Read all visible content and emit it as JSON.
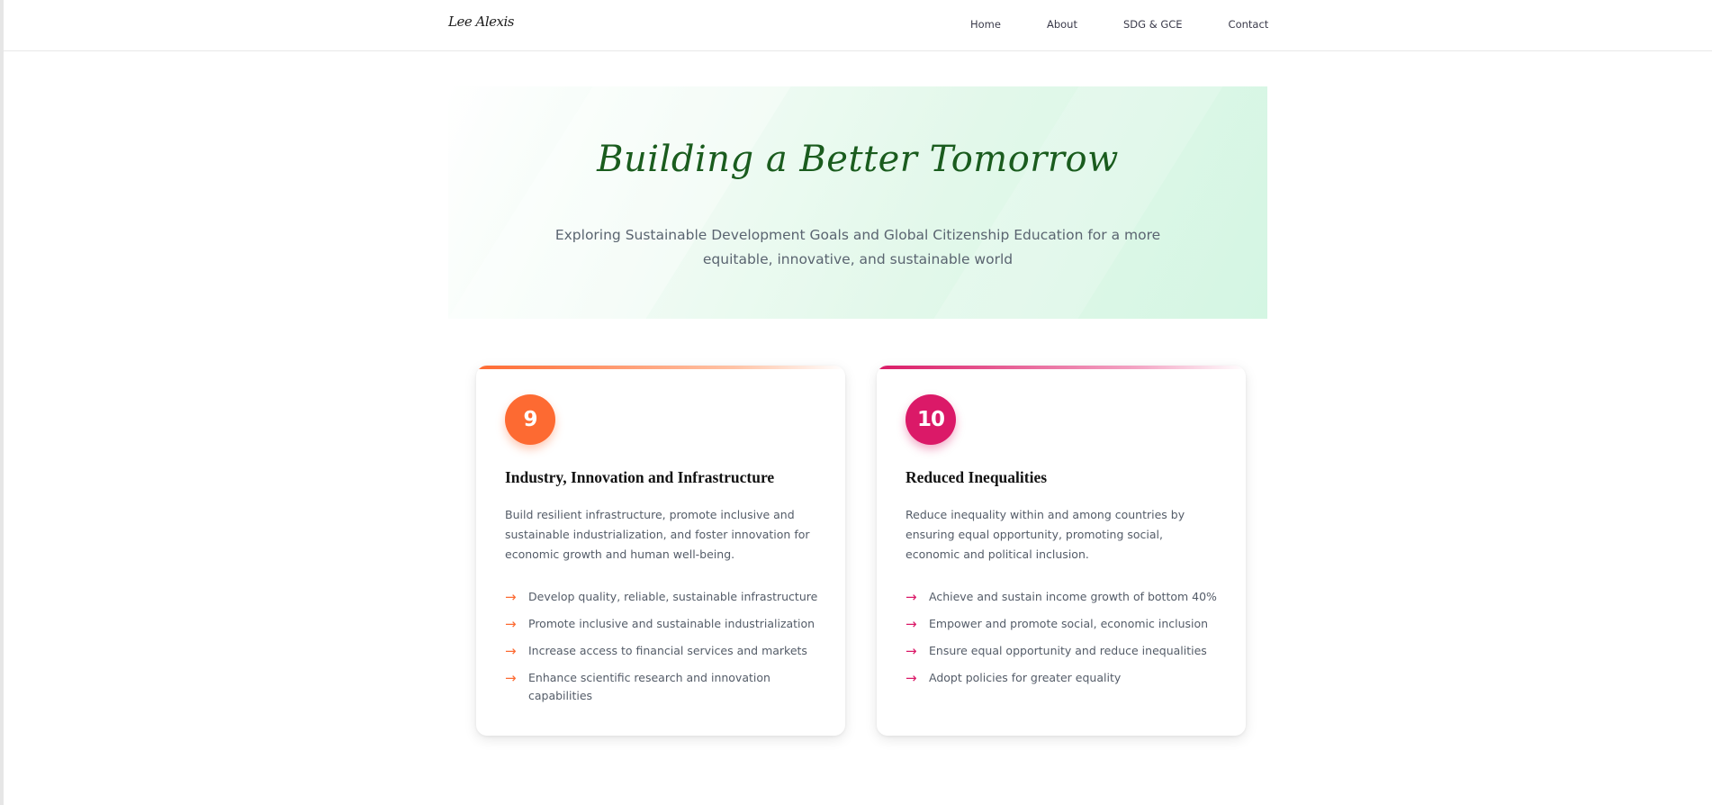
{
  "header": {
    "logo": "Lee Alexis",
    "nav": [
      {
        "label": "Home"
      },
      {
        "label": "About"
      },
      {
        "label": "SDG & GCE"
      },
      {
        "label": "Contact"
      }
    ]
  },
  "hero": {
    "title": "Building a Better Tomorrow",
    "subtitle": "Exploring Sustainable Development Goals and Global Citizenship Education for a more equitable, innovative, and sustainable world"
  },
  "cards": [
    {
      "number": "9",
      "title": "Industry, Innovation and Infrastructure",
      "description": "Build resilient infrastructure, promote inclusive and sustainable industrialization, and foster innovation for economic growth and human well-being.",
      "items": [
        "Develop quality, reliable, sustainable infrastructure",
        "Promote inclusive and sustainable industrialization",
        "Increase access to financial services and markets",
        "Enhance scientific research and innovation capabilities"
      ],
      "accent_color": "#fd6a32"
    },
    {
      "number": "10",
      "title": "Reduced Inequalities",
      "description": "Reduce inequality within and among countries by ensuring equal opportunity, promoting social, economic and political inclusion.",
      "items": [
        "Achieve and sustain income growth of bottom 40%",
        "Empower and promote social, economic inclusion",
        "Ensure equal opportunity and reduce inequalities",
        "Adopt policies for greater equality"
      ],
      "accent_color": "#db1968"
    }
  ],
  "arrow_glyph": "→",
  "colors": {
    "hero_title": "#1a5c1e",
    "hero_bg": "#d4f6e3"
  }
}
